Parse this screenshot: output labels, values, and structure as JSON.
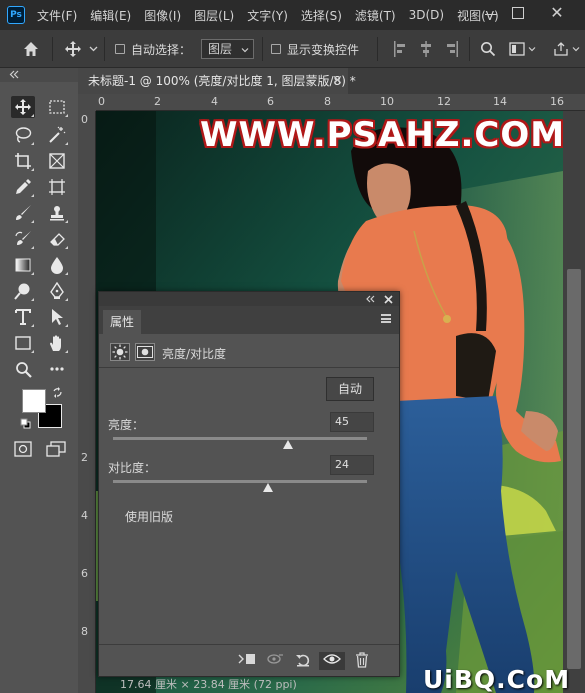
{
  "app": {
    "logo": "Ps"
  },
  "menu": [
    "文件(F)",
    "编辑(E)",
    "图像(I)",
    "图层(L)",
    "文字(Y)",
    "选择(S)",
    "滤镜(T)",
    "3D(D)",
    "视图(V)"
  ],
  "window_controls": {
    "close": "✕"
  },
  "options_bar": {
    "auto_select_label": "自动选择：",
    "auto_select_value": "图层",
    "show_transform_label": "显示变换控件"
  },
  "document": {
    "tab_title": "未标题-1 @ 100% (亮度/对比度 1, 图层蒙版/8) *",
    "tab_close": "×"
  },
  "ruler": {
    "top": [
      "0",
      "2",
      "4",
      "6",
      "8",
      "10",
      "12",
      "14",
      "16"
    ],
    "left": [
      "0",
      "2",
      "4",
      "6",
      "8"
    ]
  },
  "canvas": {
    "watermark": "WWW.PSAHZ.COM"
  },
  "properties": {
    "tab_label": "属性",
    "adjustment_title": "亮度/对比度",
    "auto_button": "自动",
    "brightness_label": "亮度：",
    "brightness_value": "45",
    "brightness_fraction": 0.69,
    "contrast_label": "对比度：",
    "contrast_value": "24",
    "contrast_fraction": 0.61,
    "legacy_label": "使用旧版"
  },
  "status_bar": "17.64 厘米 × 23.84 厘米 (72 ppi)",
  "site_logo": "UiBQ.CoM",
  "colors": {
    "menubar": "#2b2b2b",
    "panel": "#535353",
    "watermark_outline": "#b01818",
    "accent": "#31a8ff"
  }
}
